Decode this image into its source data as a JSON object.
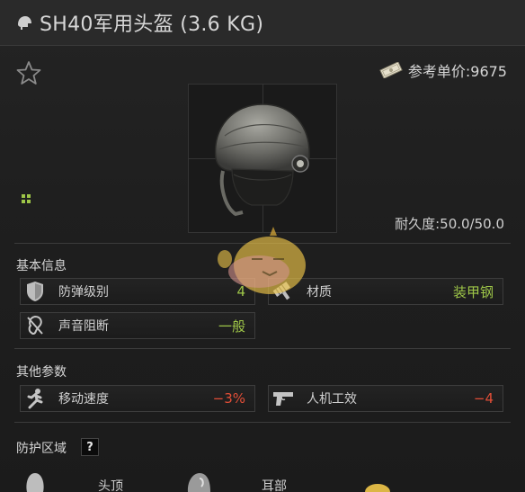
{
  "item": {
    "title": "SH40军用头盔 (3.6 KG)",
    "price_label": "参考单价:9675",
    "durability_label": "耐久度:50.0/50.0"
  },
  "icons": {
    "title": "helmet-icon",
    "favorite": "star-icon",
    "price": "cash-icon",
    "grid": "grid-size-icon"
  },
  "basic_info": {
    "heading": "基本信息",
    "stats": [
      {
        "icon": "shield-icon",
        "label": "防弹级别",
        "value": "4",
        "color": "#9ec648"
      },
      {
        "icon": "hammer-icon",
        "label": "材质",
        "value": "装甲钢",
        "color": "#9ec648"
      },
      {
        "icon": "muted-ear-icon",
        "label": "声音阻断",
        "value": "一般",
        "color": "#9ec648"
      }
    ]
  },
  "other_params": {
    "heading": "其他参数",
    "stats": [
      {
        "icon": "running-man-icon",
        "label": "移动速度",
        "value": "−3%",
        "color": "#e24e37"
      },
      {
        "icon": "pistol-icon",
        "label": "人机工效",
        "value": "−4",
        "color": "#e24e37"
      }
    ]
  },
  "protection": {
    "heading": "防护区域",
    "help": "?",
    "zones": [
      {
        "icon": "head-top-icon",
        "label": "头顶"
      },
      {
        "icon": "ear-icon",
        "label": "耳部"
      }
    ]
  },
  "colors": {
    "positive": "#9ec648",
    "negative": "#e24e37",
    "background": "#1c1c1c"
  }
}
